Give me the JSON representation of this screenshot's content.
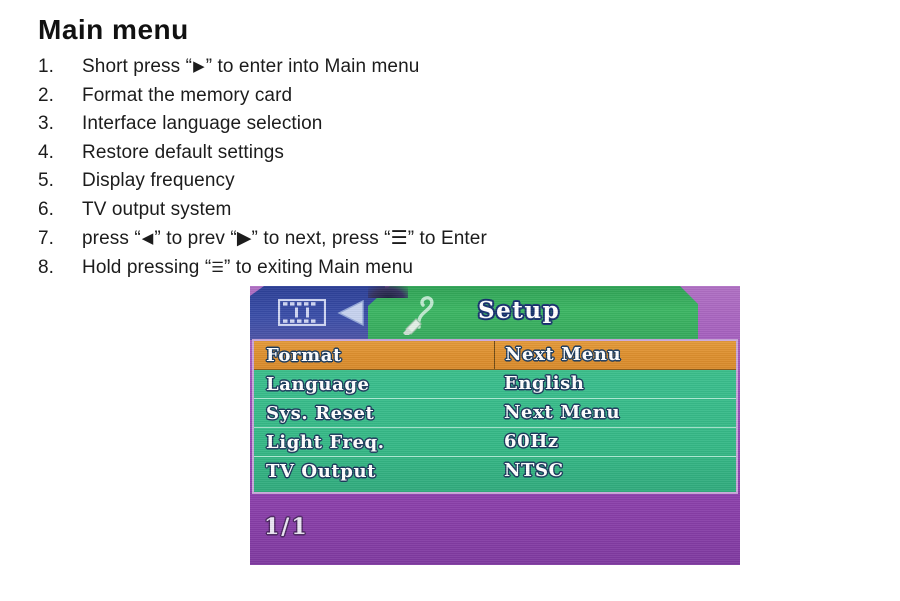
{
  "document": {
    "title": "Main menu",
    "steps": [
      {
        "num": "1.",
        "pre": "Short press  “",
        "glyph": "▶",
        "post": "”  to enter into Main menu"
      },
      {
        "num": "2.",
        "pre": "Format the memory card",
        "glyph": "",
        "post": ""
      },
      {
        "num": "3.",
        "pre": "Interface language selection",
        "glyph": "",
        "post": ""
      },
      {
        "num": "4.",
        "pre": "Restore default settings",
        "glyph": "",
        "post": ""
      },
      {
        "num": "5.",
        "pre": "Display frequency",
        "glyph": "",
        "post": ""
      },
      {
        "num": "6.",
        "pre": "TV output system",
        "glyph": "",
        "post": ""
      },
      {
        "num": "7.",
        "pre": "press  “",
        "glyph": "◀",
        "post": "” to prev  “▶”  to next,  press  “☰” to Enter"
      },
      {
        "num": "8.",
        "pre": "Hold pressing  “",
        "glyph": "☰",
        "post": "”  to exiting Main menu"
      }
    ],
    "full_lines": [
      "1.  Short press “▶”  to enter into Main menu",
      "2.  Format the memory card",
      "3.  Interface language selection",
      "4.  Restore default settings",
      "5.  Display frequency",
      "6.  TV output system",
      "7.  press “◀” to prev “▶” to next, press “☰” to Enter",
      "8.  Hold pressing “☰” to exiting Main menu"
    ]
  },
  "lcd": {
    "tabs": {
      "previous": {
        "icon": "filmstrip-icon",
        "label": ""
      },
      "back_arrow": "arrow-left-icon",
      "current": {
        "icon": "brush-icon",
        "label": "Setup"
      }
    },
    "menu_rows": [
      {
        "label": "Format",
        "value": "Next Menu",
        "selected": true
      },
      {
        "label": "Language",
        "value": "English",
        "selected": false
      },
      {
        "label": "Sys. Reset",
        "value": "Next Menu",
        "selected": false
      },
      {
        "label": "Light Freq.",
        "value": "60Hz",
        "selected": false
      },
      {
        "label": "TV Output",
        "value": "NTSC",
        "selected": false
      }
    ],
    "page_indicator": "1/1",
    "colors": {
      "tab_previous": "#3a4ea8",
      "tab_current": "#3cb663",
      "menu_background": "#35b886",
      "row_selected": "#dd8f2e",
      "screen_background": "#9a4fb8",
      "text": "#ffffff",
      "text_outline": "#1b3a5c"
    }
  }
}
